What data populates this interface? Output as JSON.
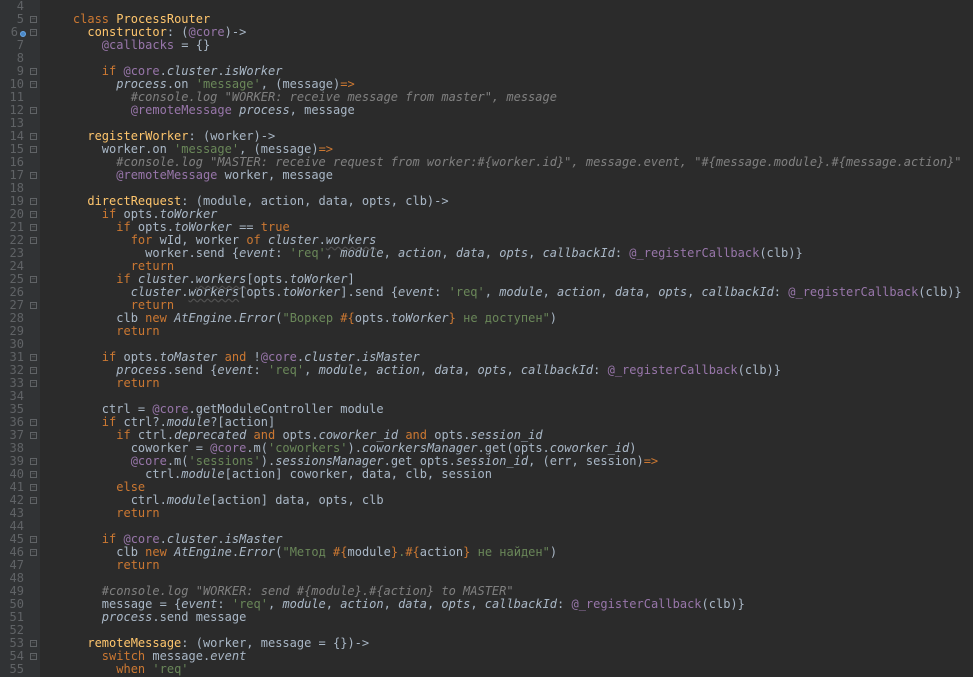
{
  "lines": [
    {
      "n": "4",
      "html": ""
    },
    {
      "n": "5",
      "html": "<span class='kw'>class</span> <span class='def'>ProcessRouter</span>"
    },
    {
      "n": "6",
      "html": "  <span class='def'>constructor</span>: (<span class='at'>@core</span>)-&gt;",
      "bp": true
    },
    {
      "n": "7",
      "html": "    <span class='at'>@callbacks</span> = {}"
    },
    {
      "n": "8",
      "html": ""
    },
    {
      "n": "9",
      "html": "    <span class='kw'>if</span> <span class='at'>@core</span>.<span class='ital'>cluster</span>.<span class='ital'>isWorker</span>"
    },
    {
      "n": "10",
      "html": "      <span class='ital'>process</span>.on <span class='str'>'message'</span>, (message)<span class='kw'>=&gt;</span>"
    },
    {
      "n": "11",
      "html": "        <span class='com'>#console.log \"WORKER: receive message from master\", message</span>"
    },
    {
      "n": "12",
      "html": "        <span class='at'>@remoteMessage</span> <span class='ital'>process</span>, message"
    },
    {
      "n": "13",
      "html": ""
    },
    {
      "n": "14",
      "html": "  <span class='def'>registerWorker</span>: (worker)-&gt;"
    },
    {
      "n": "15",
      "html": "    worker.on <span class='str'>'message'</span>, (message)<span class='kw'>=&gt;</span>"
    },
    {
      "n": "16",
      "html": "      <span class='com'>#console.log \"MASTER: receive request from worker:#{worker.id}\", message.event, \"#{message.module}.#{message.action}\"</span>"
    },
    {
      "n": "17",
      "html": "      <span class='at'>@remoteMessage</span> worker, message"
    },
    {
      "n": "18",
      "html": ""
    },
    {
      "n": "19",
      "html": "  <span class='def'>directRequest</span>: (module, action, data, opts, clb)-&gt;"
    },
    {
      "n": "20",
      "html": "    <span class='kw'>if</span> opts.<span class='ital'>toWorker</span>"
    },
    {
      "n": "21",
      "html": "      <span class='kw'>if</span> opts.<span class='ital'>toWorker</span> == <span class='kw'>true</span>"
    },
    {
      "n": "22",
      "html": "        <span class='kw'>for</span> wId, worker <span class='kw'>of</span> <span class='ital'>cluster</span>.<span class='ital underline'>workers</span>"
    },
    {
      "n": "23",
      "html": "          worker.send {<span class='ital'>event</span>: <span class='str'>'req'</span>, <span class='ital'>module</span>, <span class='ital'>action</span>, <span class='ital'>data</span>, <span class='ital'>opts</span>, <span class='ital'>callbackId</span>: <span class='at'>@_registerCallback</span>(clb)}"
    },
    {
      "n": "24",
      "html": "        <span class='kw'>return</span>"
    },
    {
      "n": "25",
      "html": "      <span class='kw'>if</span> <span class='ital'>cluster</span>.<span class='ital underline'>workers</span>[opts.<span class='ital'>toWorker</span>]"
    },
    {
      "n": "26",
      "html": "        <span class='ital'>cluster</span>.<span class='ital underline'>workers</span>[opts.<span class='ital'>toWorker</span>].send {<span class='ital'>event</span>: <span class='str'>'req'</span>, <span class='ital'>module</span>, <span class='ital'>action</span>, <span class='ital'>data</span>, <span class='ital'>opts</span>, <span class='ital'>callbackId</span>: <span class='at'>@_registerCallback</span>(clb)}"
    },
    {
      "n": "27",
      "html": "        <span class='kw'>return</span>"
    },
    {
      "n": "28",
      "html": "      clb <span class='kw'>new</span> <span class='ital'>AtEngine</span>.<span class='ital'>Error</span>(<span class='str'>\"Воркер </span><span class='kw'>#{</span>opts.<span class='ital'>toWorker</span><span class='kw'>}</span><span class='str'> не доступен\"</span>)"
    },
    {
      "n": "29",
      "html": "      <span class='kw'>return</span>"
    },
    {
      "n": "30",
      "html": ""
    },
    {
      "n": "31",
      "html": "    <span class='kw'>if</span> opts.<span class='ital'>toMaster</span> <span class='kw'>and</span> !<span class='at'>@core</span>.<span class='ital'>cluster</span>.<span class='ital'>isMaster</span>"
    },
    {
      "n": "32",
      "html": "      <span class='ital'>process</span>.send {<span class='ital'>event</span>: <span class='str'>'req'</span>, <span class='ital'>module</span>, <span class='ital'>action</span>, <span class='ital'>data</span>, <span class='ital'>opts</span>, <span class='ital'>callbackId</span>: <span class='at'>@_registerCallback</span>(clb)}"
    },
    {
      "n": "33",
      "html": "      <span class='kw'>return</span>"
    },
    {
      "n": "34",
      "html": ""
    },
    {
      "n": "35",
      "html": "    ctrl = <span class='at'>@core</span>.getModuleController module"
    },
    {
      "n": "36",
      "html": "    <span class='kw'>if</span> ctrl?.<span class='ital'>module</span>?[action]"
    },
    {
      "n": "37",
      "html": "      <span class='kw'>if</span> ctrl.<span class='ital'>deprecated</span> <span class='kw'>and</span> opts.<span class='ital'>coworker_id</span> <span class='kw'>and</span> opts.<span class='ital'>session_id</span>"
    },
    {
      "n": "38",
      "html": "        coworker = <span class='at'>@core</span>.m(<span class='str'>'coworkers'</span>).<span class='ital'>coworkersManager</span>.get(opts.<span class='ital'>coworker_id</span>)"
    },
    {
      "n": "39",
      "html": "        <span class='at'>@core</span>.m(<span class='str'>'sessions'</span>).<span class='ital'>sessionsManager</span>.get opts.<span class='ital'>session_id</span>, (err, session)<span class='kw'>=&gt;</span>"
    },
    {
      "n": "40",
      "html": "          ctrl.<span class='ital'>module</span>[action] coworker, data, clb, session"
    },
    {
      "n": "41",
      "html": "      <span class='kw'>else</span>"
    },
    {
      "n": "42",
      "html": "        ctrl.<span class='ital'>module</span>[action] data, opts, clb"
    },
    {
      "n": "43",
      "html": "      <span class='kw'>return</span>"
    },
    {
      "n": "44",
      "html": ""
    },
    {
      "n": "45",
      "html": "    <span class='kw'>if</span> <span class='at'>@core</span>.<span class='ital'>cluster</span>.<span class='ital'>isMaster</span>"
    },
    {
      "n": "46",
      "html": "      clb <span class='kw'>new</span> <span class='ital'>AtEngine</span>.<span class='ital'>Error</span>(<span class='str'>\"Метод </span><span class='kw'>#{</span>module<span class='kw'>}</span><span class='str'>.</span><span class='kw'>#{</span>action<span class='kw'>}</span><span class='str'> не найден\"</span>)"
    },
    {
      "n": "47",
      "html": "      <span class='kw'>return</span>"
    },
    {
      "n": "48",
      "html": ""
    },
    {
      "n": "49",
      "html": "    <span class='com'>#console.log \"WORKER: send #{module}.#{action} to MASTER\"</span>"
    },
    {
      "n": "50",
      "html": "    message = {<span class='ital'>event</span>: <span class='str'>'req'</span>, <span class='ital'>module</span>, <span class='ital'>action</span>, <span class='ital'>data</span>, <span class='ital'>opts</span>, <span class='ital'>callbackId</span>: <span class='at'>@_registerCallback</span>(clb)}"
    },
    {
      "n": "51",
      "html": "    <span class='ital'>process</span>.send message"
    },
    {
      "n": "52",
      "html": ""
    },
    {
      "n": "53",
      "html": "  <span class='def'>remoteMessage</span>: (worker, message = {})-&gt;"
    },
    {
      "n": "54",
      "html": "    <span class='kw'>switch</span> message.<span class='ital'>event</span>"
    },
    {
      "n": "55",
      "html": "      <span class='kw'>when</span> <span class='str'>'req'</span>"
    }
  ],
  "indent_unit": "  ",
  "base_indent": 2
}
